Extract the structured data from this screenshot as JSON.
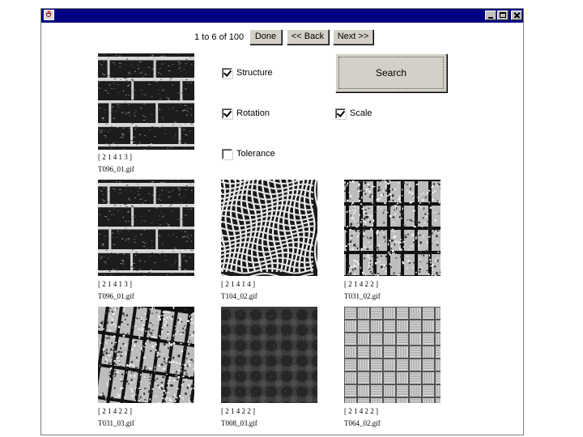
{
  "window": {
    "title": "",
    "icon": "java-cup-icon",
    "controls": [
      "minimize-icon",
      "maximize-icon",
      "close-icon"
    ]
  },
  "nav": {
    "counter": "1 to 6 of 100",
    "done_label": "Done",
    "back_label": "<< Back",
    "next_label": "Next >>"
  },
  "query": {
    "vector": "[ 2 1 4 1 3 ]",
    "filename": "T096_01.gif",
    "texture": "brick-dark"
  },
  "options": {
    "structure": {
      "label": "Structure",
      "checked": true
    },
    "rotation": {
      "label": "Rotation",
      "checked": true
    },
    "scale": {
      "label": "Scale",
      "checked": true
    },
    "tolerance": {
      "label": "Tolerance",
      "checked": false
    }
  },
  "search_label": "Search",
  "results": [
    {
      "vector": "[ 2 1 4 1 3 ]",
      "filename": "T096_01.gif",
      "texture": "brick-dark"
    },
    {
      "vector": "[ 2 1 4 1 4 ]",
      "filename": "T104_02.gif",
      "texture": "wavy-grid"
    },
    {
      "vector": "[ 2 1 4 2 2 ]",
      "filename": "T031_02.gif",
      "texture": "tiles-vertical"
    },
    {
      "vector": "[ 2 1 4 2 2 ]",
      "filename": "T031_03.gif",
      "texture": "tiles-slanted"
    },
    {
      "vector": "[ 2 1 4 2 2 ]",
      "filename": "T008_03.gif",
      "texture": "dark-dots"
    },
    {
      "vector": "[ 2 1 4 2 2 ]",
      "filename": "T064_02.gif",
      "texture": "basket-weave"
    }
  ]
}
